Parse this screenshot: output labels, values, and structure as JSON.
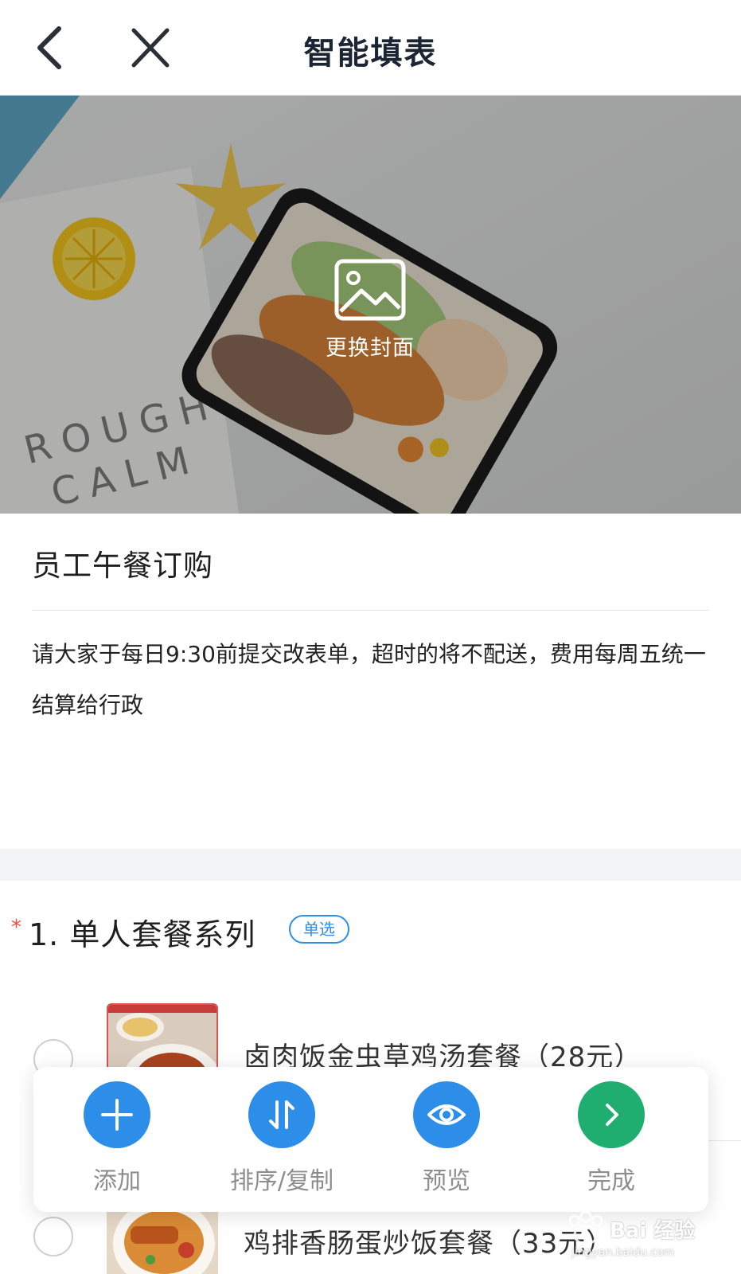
{
  "header": {
    "title": "智能填表",
    "back_icon": "chevron-left-icon",
    "close_icon": "close-icon"
  },
  "cover": {
    "change_label": "更换封面",
    "icon": "image-icon",
    "art_text_line1": "ROUGH",
    "art_text_line2": "CALM"
  },
  "form": {
    "title": "员工午餐订购",
    "description": "请大家于每日9:30前提交改表单，超时的将不配送，费用每周五统一结算给行政"
  },
  "question": {
    "required_mark": "*",
    "title": "1. 单人套餐系列",
    "badge": "单选",
    "options": [
      {
        "label": "卤肉饭金虫草鸡汤套餐（28元）"
      },
      {
        "label": "鸡排香肠蛋炒饭套餐（33元）"
      }
    ]
  },
  "toolbar": {
    "items": [
      {
        "label": "添加",
        "icon": "plus-icon",
        "color": "#2c8ee9"
      },
      {
        "label": "排序/复制",
        "icon": "sort-icon",
        "color": "#2c8ee9"
      },
      {
        "label": "预览",
        "icon": "eye-icon",
        "color": "#2c8ee9"
      },
      {
        "label": "完成",
        "icon": "chevron-right-icon",
        "color": "#1fae6f"
      }
    ]
  },
  "watermark": {
    "text": "Bai 经验",
    "sub": "jingyan.baidu.com"
  }
}
